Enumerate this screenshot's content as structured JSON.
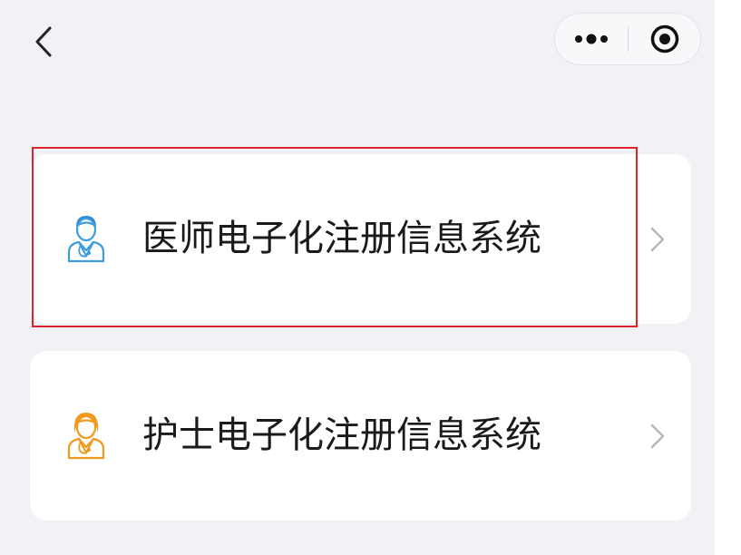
{
  "nav": {
    "back_icon": "chevron-left-icon",
    "more_icon": "more-dots-icon",
    "close_icon": "target-circle-icon"
  },
  "menu": {
    "items": [
      {
        "label": "医师电子化注册信息系统",
        "icon": "doctor-icon",
        "icon_color": "#3d9be0",
        "chevron": "chevron-right-icon",
        "highlighted": true
      },
      {
        "label": "护士电子化注册信息系统",
        "icon": "nurse-icon",
        "icon_color": "#ef9a1c",
        "chevron": "chevron-right-icon",
        "highlighted": false
      }
    ]
  },
  "colors": {
    "page_background": "#f1f1f6",
    "card_background": "#ffffff",
    "highlight_border": "#e0232a",
    "text": "#1a1a1a",
    "chevron": "#b5b5bb"
  }
}
